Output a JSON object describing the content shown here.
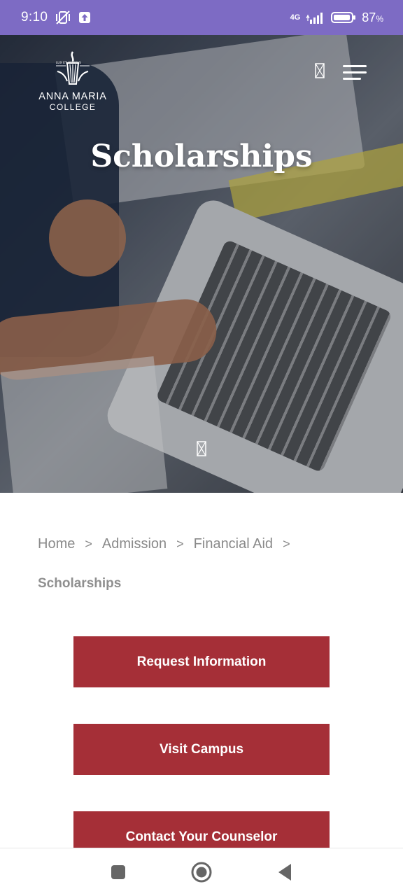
{
  "status_bar": {
    "time": "9:10",
    "network": "4G",
    "battery": "87",
    "battery_unit": "%",
    "icons": [
      "vibrate-off-icon",
      "upload-icon",
      "signal-icon",
      "battery-icon"
    ]
  },
  "header": {
    "logo_motto": "LUX ET VERITAS",
    "logo_name": "ANNA MARIA",
    "logo_sub": "COLLEGE",
    "icons": [
      "search-icon",
      "hamburger-menu-icon"
    ]
  },
  "hero": {
    "title": "Scholarships",
    "scroll_icon": "scroll-down-icon"
  },
  "breadcrumb": {
    "items": [
      "Home",
      "Admission",
      "Financial Aid"
    ],
    "separator": ">",
    "current": "Scholarships"
  },
  "cta": {
    "request_info": "Request Information",
    "visit_campus": "Visit Campus",
    "contact_counselor": "Contact Your Counselor"
  },
  "colors": {
    "status_bar": "#7d6bc4",
    "cta_background": "#a52f37",
    "breadcrumb_text": "#8a8a8a"
  },
  "nav_bar": {
    "icons": [
      "recents-square-icon",
      "home-circle-icon",
      "back-triangle-icon"
    ]
  }
}
